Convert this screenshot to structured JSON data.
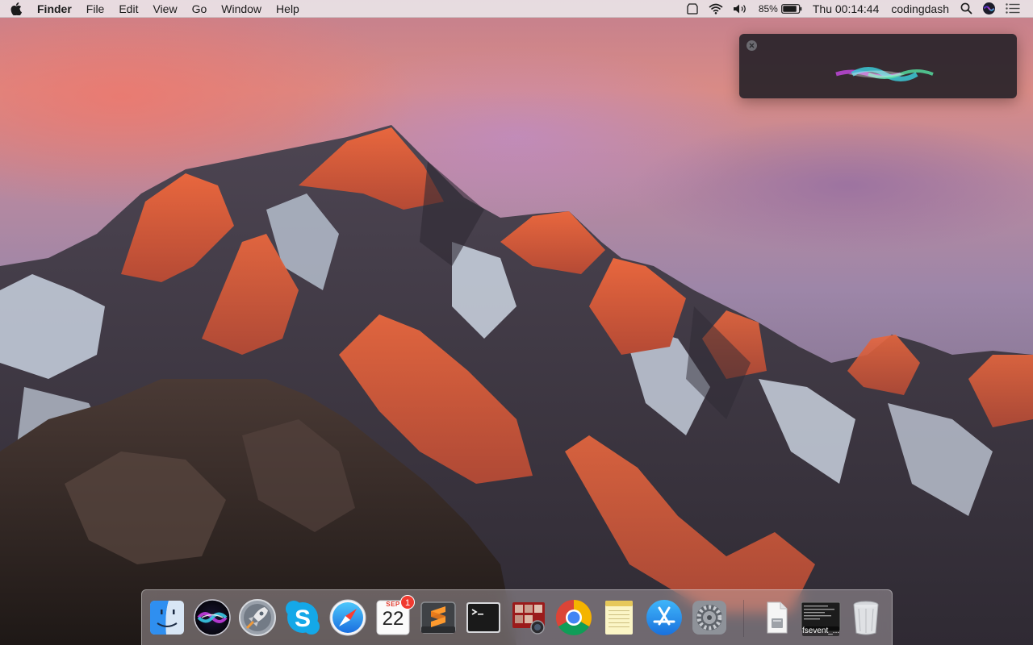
{
  "menubar": {
    "app_name": "Finder",
    "menus": [
      "File",
      "Edit",
      "View",
      "Go",
      "Window",
      "Help"
    ],
    "battery_percent": "85%",
    "clock": "Thu 00:14:44",
    "user": "codingdash"
  },
  "siri": {
    "close_icon": "close-icon",
    "wave_colors": [
      "#d14cf0",
      "#3cc9d6",
      "#56e3a4"
    ]
  },
  "dock": {
    "apps": [
      {
        "name": "Finder",
        "running": true
      },
      {
        "name": "Siri",
        "running": false
      },
      {
        "name": "Launchpad",
        "running": false
      },
      {
        "name": "Skype",
        "running": true
      },
      {
        "name": "Safari",
        "running": false
      },
      {
        "name": "Calendar",
        "running": false,
        "month": "SEP",
        "day": "22",
        "badge": "1"
      },
      {
        "name": "Sublime Text",
        "running": true
      },
      {
        "name": "Terminal",
        "running": true
      },
      {
        "name": "Photo Booth",
        "running": false
      },
      {
        "name": "Google Chrome",
        "running": true
      },
      {
        "name": "Notes",
        "running": false
      },
      {
        "name": "App Store",
        "running": false
      },
      {
        "name": "System Preferences",
        "running": false
      }
    ],
    "others": [
      {
        "name": "Downloads stack"
      },
      {
        "name": "fsevent window",
        "label": "fsevent_..."
      },
      {
        "name": "Trash"
      }
    ]
  }
}
